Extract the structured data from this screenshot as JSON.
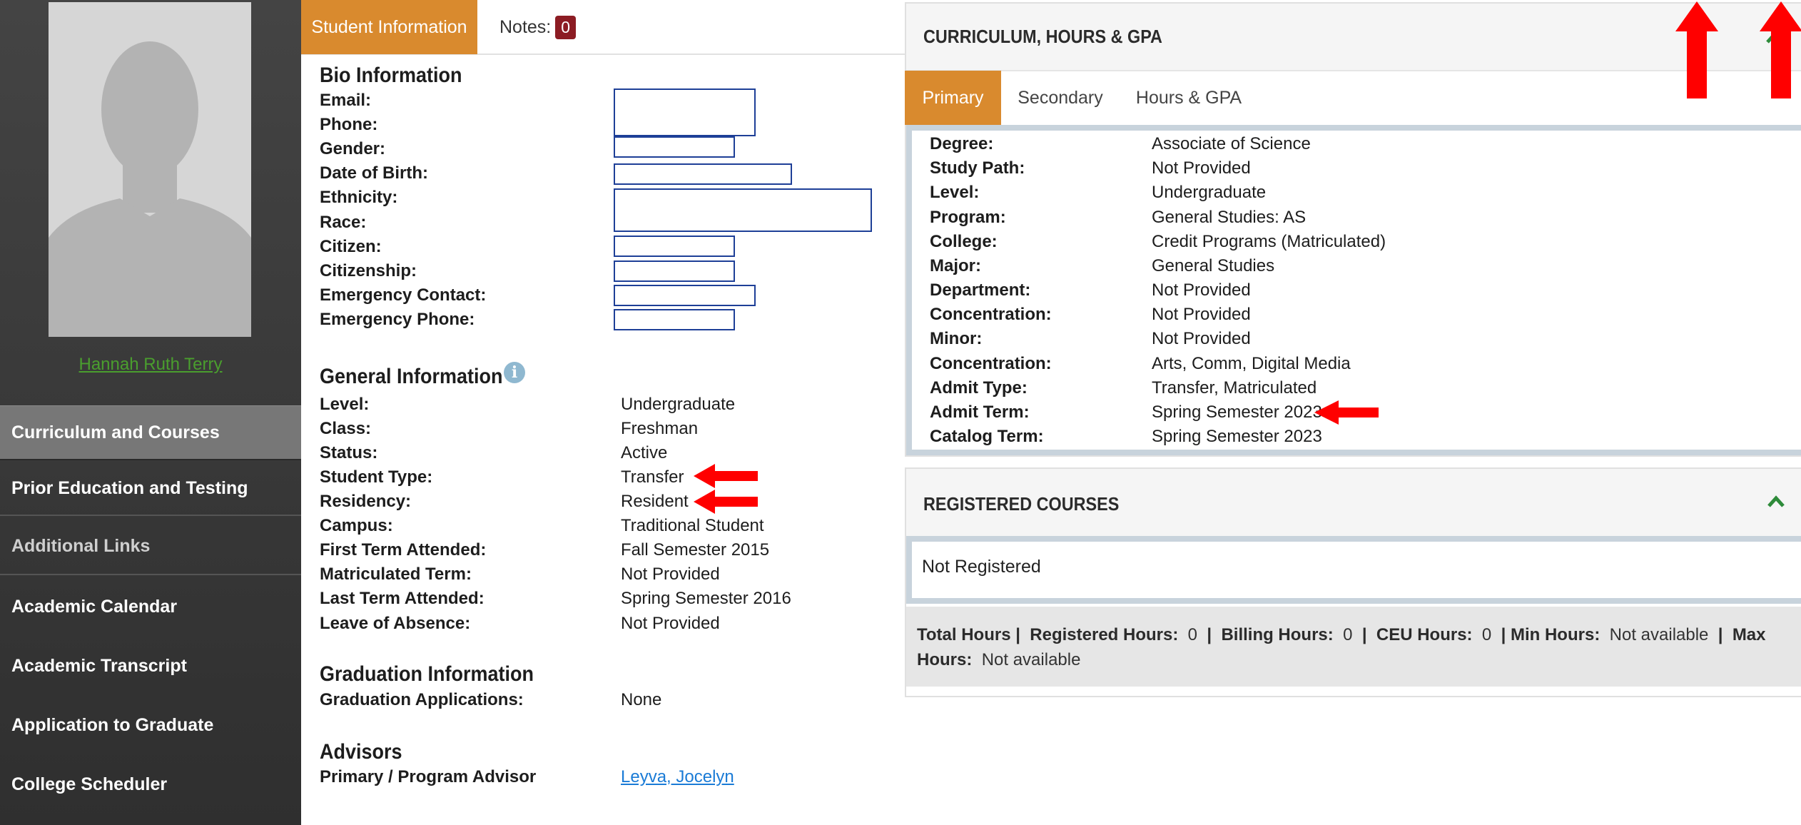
{
  "student": {
    "name": "Hannah Ruth Terry"
  },
  "sidebar": {
    "items": [
      {
        "label": "Curriculum and Courses"
      },
      {
        "label": "Prior Education and Testing"
      },
      {
        "label": "Additional Links"
      },
      {
        "label": "Academic Calendar"
      },
      {
        "label": "Academic Transcript"
      },
      {
        "label": "Application to Graduate"
      },
      {
        "label": "College Scheduler"
      }
    ]
  },
  "tabs": {
    "student_info": "Student Information",
    "notes_label": "Notes:",
    "notes_count": "0"
  },
  "bio": {
    "title": "Bio Information",
    "labels": [
      "Email:",
      "Phone:",
      "Gender:",
      "Date of Birth:",
      "Ethnicity:",
      "Race:",
      "Citizen:",
      "Citizenship:",
      "Emergency Contact:",
      "Emergency Phone:"
    ]
  },
  "general": {
    "title": "General Information",
    "rows": [
      {
        "label": "Level:",
        "value": "Undergraduate"
      },
      {
        "label": "Class:",
        "value": "Freshman"
      },
      {
        "label": "Status:",
        "value": "Active"
      },
      {
        "label": "Student Type:",
        "value": "Transfer"
      },
      {
        "label": "Residency:",
        "value": "Resident"
      },
      {
        "label": "Campus:",
        "value": "Traditional Student"
      },
      {
        "label": "First Term Attended:",
        "value": "Fall Semester 2015"
      },
      {
        "label": "Matriculated Term:",
        "value": "Not Provided"
      },
      {
        "label": "Last Term Attended:",
        "value": "Spring Semester 2016"
      },
      {
        "label": "Leave of Absence:",
        "value": "Not Provided"
      }
    ]
  },
  "graduation": {
    "title": "Graduation Information",
    "label": "Graduation Applications:",
    "value": "None"
  },
  "advisors": {
    "title": "Advisors",
    "label": "Primary / Program Advisor",
    "value": "Leyva, Jocelyn"
  },
  "curriculum": {
    "title": "CURRICULUM, HOURS & GPA",
    "tabs": [
      "Primary",
      "Secondary",
      "Hours & GPA"
    ],
    "rows": [
      {
        "label": "Degree:",
        "value": "Associate of Science"
      },
      {
        "label": "Study Path:",
        "value": "Not Provided"
      },
      {
        "label": "Level:",
        "value": "Undergraduate"
      },
      {
        "label": "Program:",
        "value": "General Studies: AS"
      },
      {
        "label": "College:",
        "value": "Credit Programs (Matriculated)"
      },
      {
        "label": "Major:",
        "value": "General Studies"
      },
      {
        "label": "Department:",
        "value": "Not Provided"
      },
      {
        "label": "Concentration:",
        "value": "Not Provided"
      },
      {
        "label": "Minor:",
        "value": "Not Provided"
      },
      {
        "label": "Concentration:",
        "value": "Arts, Comm, Digital Media"
      },
      {
        "label": "Admit Type:",
        "value": "Transfer, Matriculated"
      },
      {
        "label": "Admit Term:",
        "value": "Spring Semester 2023"
      },
      {
        "label": "Catalog Term:",
        "value": "Spring Semester 2023"
      }
    ]
  },
  "registered": {
    "title": "REGISTERED COURSES",
    "status": "Not Registered",
    "totals": {
      "total_label": "Total Hours |",
      "registered_label": "Registered Hours:",
      "registered_value": "0",
      "billing_label": "Billing Hours:",
      "billing_value": "0",
      "ceu_label": "CEU Hours:",
      "ceu_value": "0",
      "min_label": "Min Hours:",
      "min_value": "Not available",
      "max_label": "Max Hours:",
      "max_value": "Not available"
    }
  },
  "colors": {
    "accent": "#d98a2e",
    "badge": "#8c1c23",
    "annotation": "#ff0000",
    "link": "#1a7bd6",
    "chevron": "#2e8b3a"
  }
}
